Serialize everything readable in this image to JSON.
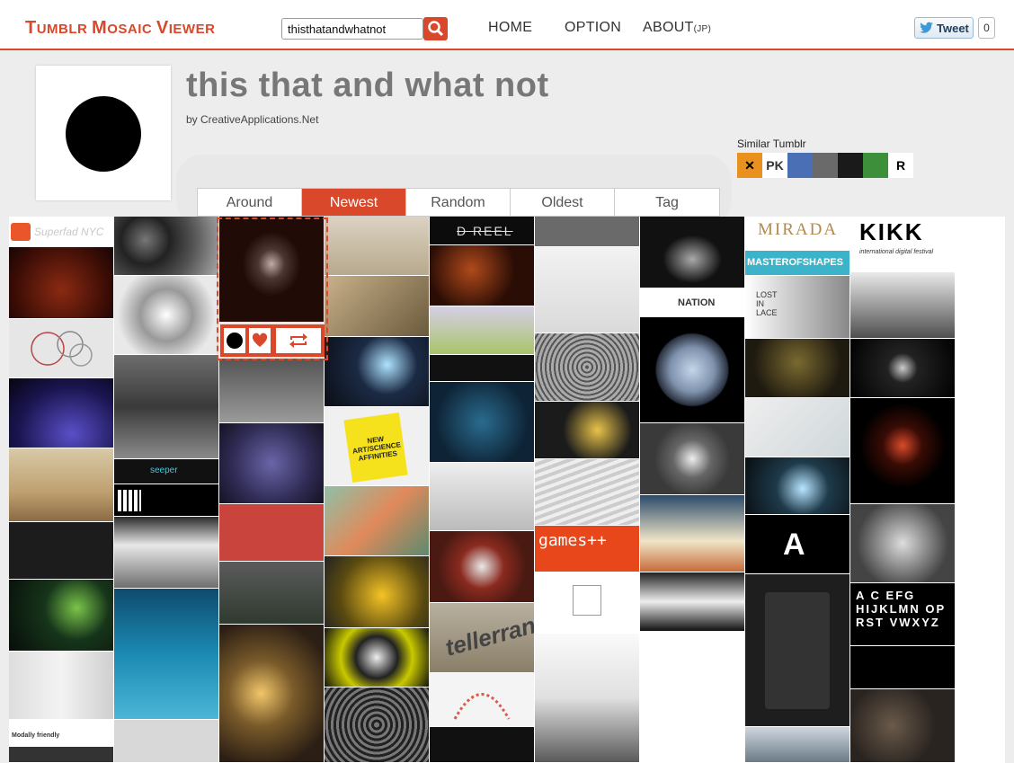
{
  "topbar": {
    "logo_t": "T",
    "logo_umblr": "UMBLR ",
    "logo_m": "M",
    "logo_osaic": "OSAIC ",
    "logo_v": "V",
    "logo_iewer": "IEWER",
    "search_value": "thisthatandwhatnot",
    "nav_home": "HOME",
    "nav_option": "OPTION",
    "nav_about": "ABOUT",
    "nav_about_suffix": "(JP)",
    "tweet_label": "Tweet",
    "tweet_count": "0"
  },
  "blog": {
    "title": "this that and what not",
    "byline": "by CreativeApplications.Net"
  },
  "tabs": [
    "Around",
    "Newest",
    "Random",
    "Oldest",
    "Tag"
  ],
  "active_tab": "Newest",
  "similar": {
    "label": "Similar Tumblr",
    "items": [
      {
        "text": "✕",
        "bg": "#e8911f",
        "color": "#000"
      },
      {
        "text": "PK",
        "bg": "#ffffff",
        "color": "#333"
      },
      {
        "text": "",
        "bg": "#4a6fb5",
        "color": "#000"
      },
      {
        "text": "",
        "bg": "#6a6a6a",
        "color": "#000"
      },
      {
        "text": "",
        "bg": "#1a1a1a",
        "color": "#000"
      },
      {
        "text": "",
        "bg": "#3e8f3a",
        "color": "#000"
      },
      {
        "text": "R",
        "bg": "#ffffff",
        "color": "#000"
      }
    ]
  },
  "mosaic_texts": {
    "superfad": "Superfad NYC",
    "dreel": "D REEL",
    "nation": "NATION",
    "mirada": "MIRADA",
    "masterofshapes": "MASTEROFSHAPES",
    "kikk": "KIKK",
    "kikk_sub": "international digital festival",
    "lost_in_lace": "LOST IN LACE",
    "art_science": "NEW ART/SCIENCE AFFINITIES",
    "games": "games++",
    "seeper": "seeper",
    "tellerrand": "tellerrand",
    "alphabet": "A C EFG HIJKLMN OP RST VWXYZ",
    "letter_a": "A",
    "modally": "Modally friendly"
  },
  "colors": {
    "accent": "#d9482b",
    "tab_active_text": "#ffffff"
  }
}
